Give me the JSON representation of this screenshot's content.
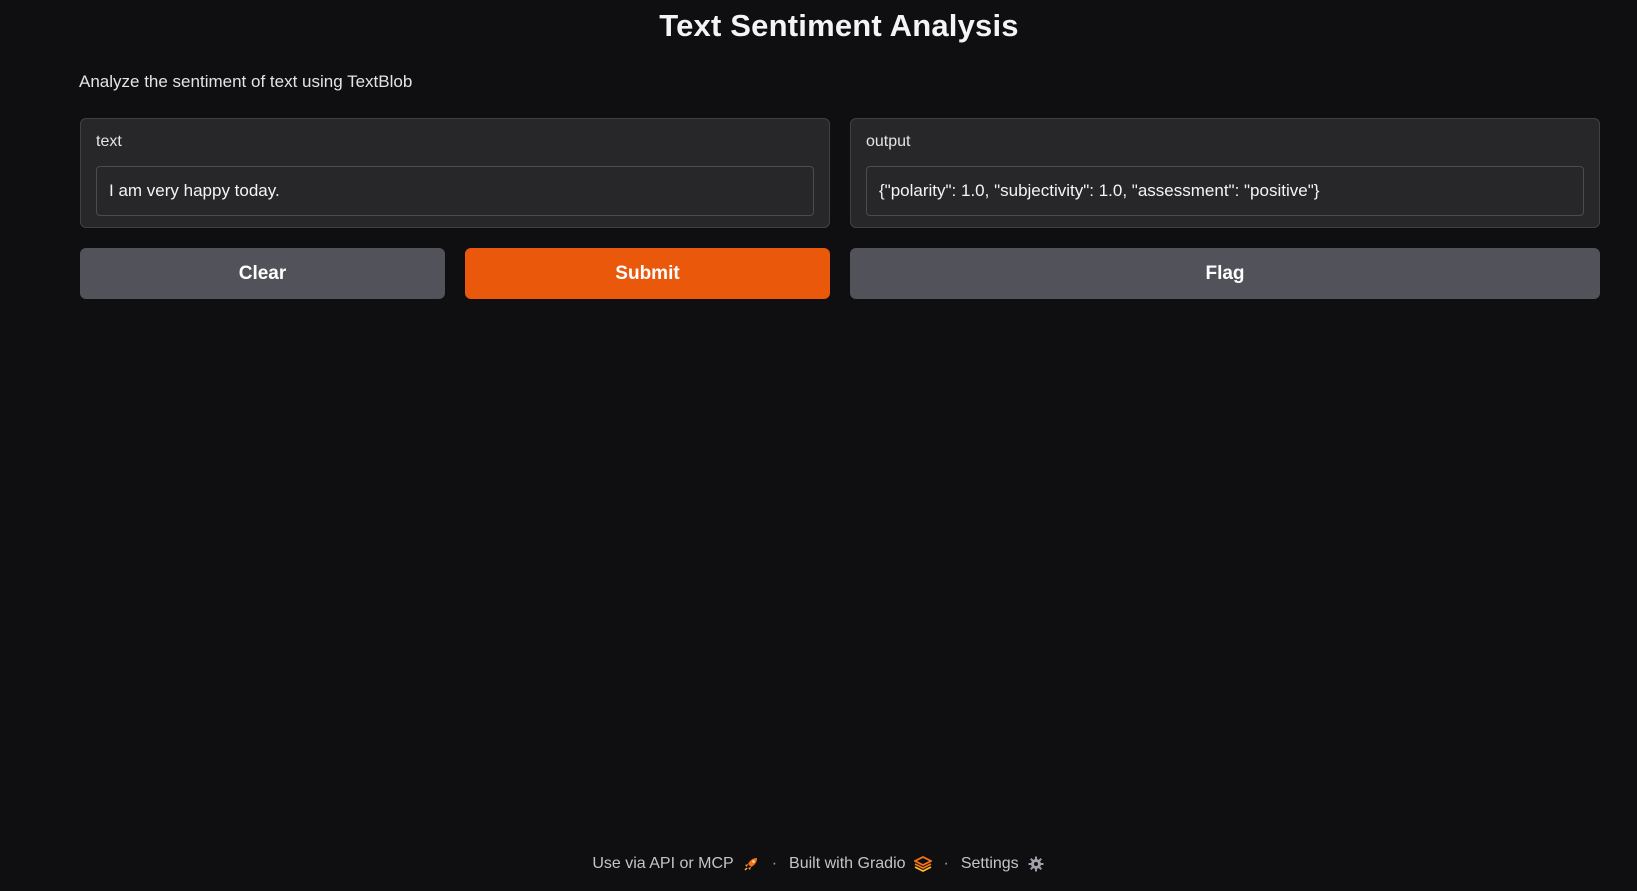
{
  "app": {
    "title": "Text Sentiment Analysis",
    "description": "Analyze the sentiment of text using TextBlob"
  },
  "input_panel": {
    "label": "text",
    "value": "I am very happy today."
  },
  "output_panel": {
    "label": "output",
    "value": "{\"polarity\": 1.0, \"subjectivity\": 1.0, \"assessment\": \"positive\"}"
  },
  "buttons": {
    "clear_label": "Clear",
    "submit_label": "Submit",
    "flag_label": "Flag"
  },
  "footer": {
    "api_label": "Use via API or MCP",
    "api_icon": "rocket-icon",
    "separator": "·",
    "built_label": "Built with Gradio",
    "built_icon": "gradio-logo-icon",
    "settings_label": "Settings",
    "settings_icon": "gear-icon"
  },
  "colors": {
    "background": "#0f0f11",
    "panel": "#27272a",
    "accent": "#ea580c",
    "secondary_button": "#52525b"
  }
}
